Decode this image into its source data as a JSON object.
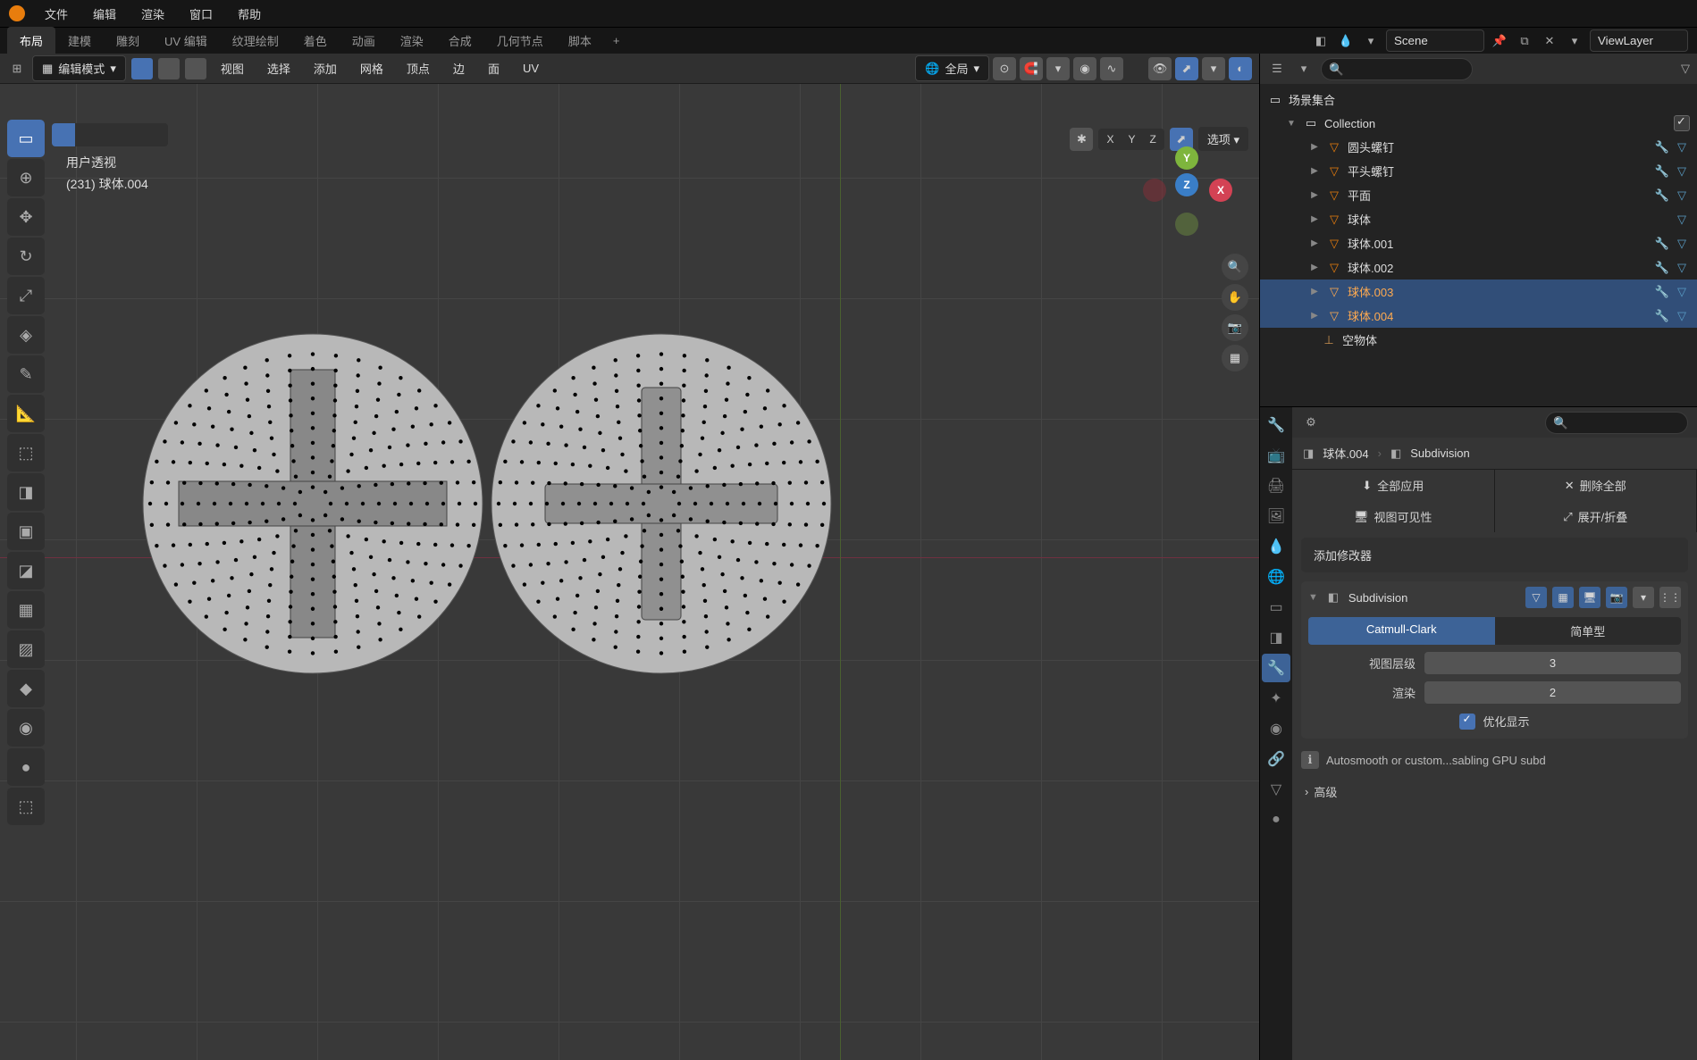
{
  "menu": {
    "items": [
      "文件",
      "编辑",
      "渲染",
      "窗口",
      "帮助"
    ]
  },
  "workspaces": {
    "tabs": [
      "布局",
      "建模",
      "雕刻",
      "UV 编辑",
      "纹理绘制",
      "着色",
      "动画",
      "渲染",
      "合成",
      "几何节点",
      "脚本"
    ],
    "active_index": 0,
    "add": "+"
  },
  "header_right": {
    "scene_label": "Scene",
    "viewlayer_label": "ViewLayer"
  },
  "viewport": {
    "mode_label": "编辑模式",
    "menu_items": [
      "视图",
      "选择",
      "添加",
      "网格",
      "顶点",
      "边",
      "面",
      "UV"
    ],
    "global_label": "全局",
    "overlay_title": "用户透视",
    "overlay_info": "(231) 球体.004",
    "options_label": "选项",
    "axes": {
      "x": "X",
      "y": "Y",
      "z": "Z"
    }
  },
  "outliner": {
    "scene_collection": "场景集合",
    "collection": "Collection",
    "items": [
      {
        "label": "圆头螺钉",
        "selected": false
      },
      {
        "label": "平头螺钉",
        "selected": false
      },
      {
        "label": "平面",
        "selected": false
      },
      {
        "label": "球体",
        "selected": false
      },
      {
        "label": "球体.001",
        "selected": false
      },
      {
        "label": "球体.002",
        "selected": false
      },
      {
        "label": "球体.003",
        "selected": true
      },
      {
        "label": "球体.004",
        "selected": true
      },
      {
        "label": "空物体",
        "selected": false,
        "empty": true
      }
    ]
  },
  "properties": {
    "breadcrumb_obj": "球体.004",
    "breadcrumb_mod": "Subdivision",
    "apply_all": "全部应用",
    "delete_all": "删除全部",
    "view_visibility": "视图可见性",
    "expand_collapse": "展开/折叠",
    "add_modifier": "添加修改器",
    "modifier": {
      "name": "Subdivision",
      "type_catmull": "Catmull-Clark",
      "type_simple": "简单型",
      "viewport_levels_label": "视图层级",
      "viewport_levels_value": "3",
      "render_label": "渲染",
      "render_value": "2",
      "optimize_label": "优化显示",
      "info_text": "Autosmooth or custom...sabling GPU subd",
      "advanced": "高级"
    }
  }
}
